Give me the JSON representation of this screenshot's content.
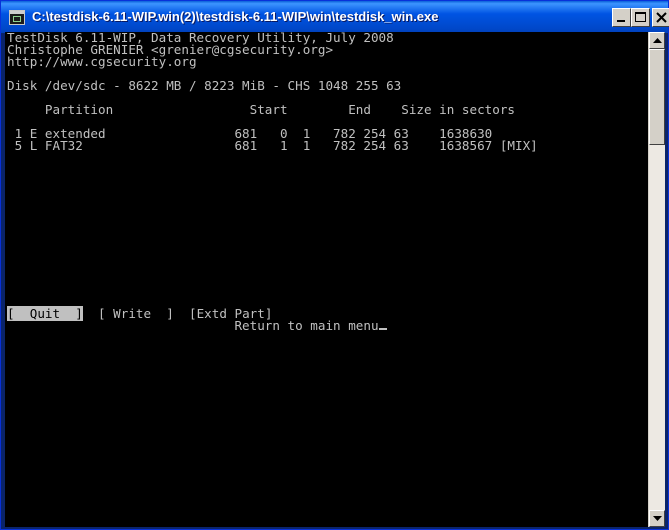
{
  "window": {
    "title": "C:\\testdisk-6.11-WIP.win(2)\\testdisk-6.11-WIP\\win\\testdisk_win.exe"
  },
  "console": {
    "header": [
      "TestDisk 6.11-WIP, Data Recovery Utility, July 2008",
      "Christophe GRENIER <grenier@cgsecurity.org>",
      "http://www.cgsecurity.org"
    ],
    "disk_info": "Disk /dev/sdc - 8622 MB / 8223 MiB - CHS 1048 255 63",
    "table_header": "     Partition                  Start        End    Size in sectors",
    "partitions": [
      " 1 E extended                 681   0  1   782 254 63    1638630",
      " 5 L FAT32                    681   1  1   782 254 63    1638567 [MIX]"
    ],
    "menu": {
      "quit": "[  Quit  ]",
      "write": "[ Write  ]",
      "extd_part": "[Extd Part]"
    },
    "hint": "Return to main menu"
  },
  "icons": [
    "app-console-icon",
    "minimize-icon",
    "maximize-icon",
    "close-icon",
    "scroll-up-arrow-icon",
    "scroll-down-arrow-icon"
  ]
}
